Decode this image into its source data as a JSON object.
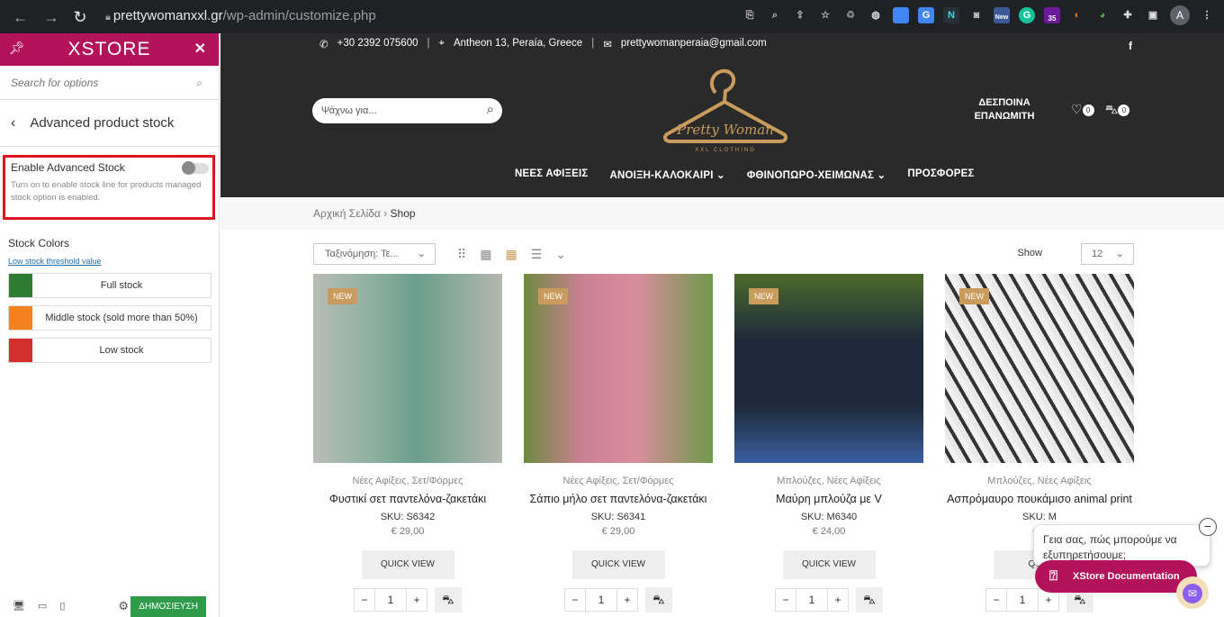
{
  "browser": {
    "url_host": "prettywomanxxl.gr",
    "url_path": "/wp-admin/customize.php",
    "avatar_letter": "A",
    "ext_badges": [
      "New",
      "35"
    ]
  },
  "sidebar": {
    "logo": "XSTORE",
    "search_placeholder": "Search for options",
    "section_title": "Advanced product stock",
    "setting_label": "Enable Advanced Stock",
    "setting_desc": "Turn on to enable stock line for products managed stock option is enabled.",
    "stock_colors_title": "Stock Colors",
    "threshold_link": "Low stock threshold value",
    "swatches": [
      {
        "label": "Full stock",
        "color": "#2e7d32"
      },
      {
        "label": "Middle stock (sold more than 50%)",
        "color": "#f5821f"
      },
      {
        "label": "Low stock",
        "color": "#d32f2f"
      }
    ],
    "publish": "ΔΗΜΟΣΙΕΥΣΗ"
  },
  "site": {
    "phone": "+30 2392 075600",
    "address": "Antheon 13, Peraía, Greece",
    "email": "prettywomanperaia@gmail.com",
    "search_placeholder": "Ψάχνω για...",
    "logo_text": "Pretty Woman",
    "logo_sub": "XXL CLOTHING",
    "account": "ΔΕΣΠΟΙΝΑ ΕΠΑΝΩΜΙΤΗ",
    "wishlist_count": "0",
    "cart_count": "0",
    "menu": [
      "ΝΕΕΣ ΑΦΙΞΕΙΣ",
      "ΑΝΟΙΞΗ-ΚΑΛΟΚΑΙΡΙ ⌄",
      "ΦΘΙΝΟΠΩΡΟ-ΧΕΙΜΩΝΑΣ ⌄",
      "ΠΡΟΣΦΟΡΕΣ"
    ],
    "breadcrumb_home": "Αρχική Σελίδα",
    "breadcrumb_current": "Shop",
    "sort_label": "Ταξινόμηση: Τε...",
    "show_label": "Show",
    "show_value": "12",
    "products": [
      {
        "badge": "NEW",
        "cats": "Νέες Αφίξεις, Σετ/Φόρμες",
        "title": "Φυστικί σετ παντελόνα-ζακετάκι",
        "sku": "SKU: S6342",
        "price": "€ 29,00",
        "quick": "QUICK VIEW",
        "qty": "1",
        "bg": "#6a9e8c"
      },
      {
        "badge": "NEW",
        "cats": "Νέες Αφίξεις, Σετ/Φόρμες",
        "title": "Σάπιο μήλο σετ παντελόνα-ζακετάκι",
        "sku": "SKU: S6341",
        "price": "€ 29,00",
        "quick": "QUICK VIEW",
        "qty": "1",
        "bg": "#c98090"
      },
      {
        "badge": "NEW",
        "cats": "Μπλούζες, Νέες Αφίξεις",
        "title": "Μαύρη μπλούζα με V",
        "sku": "SKU: M6340",
        "price": "€ 24,00",
        "quick": "QUICK VIEW",
        "qty": "1",
        "bg": "#1e2a3a"
      },
      {
        "badge": "NEW",
        "cats": "Μπλούζες, Νέες Αφίξεις",
        "title": "Ασπρόμαυρο πουκάμισο animal print",
        "sku": "SKU: M",
        "price": "€ 4",
        "quick": "QUIC",
        "qty": "1",
        "bg": "#555555"
      }
    ],
    "chat_text": "Γεια σας, πώς μπορούμε να εξυπηρετήσουμε;",
    "doc_button": "XStore Documentation"
  }
}
